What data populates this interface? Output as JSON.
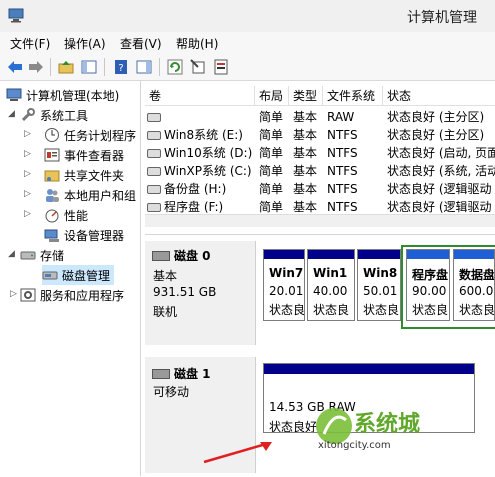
{
  "window": {
    "title": "计算机管理"
  },
  "menu": [
    "文件(F)",
    "操作(A)",
    "查看(V)",
    "帮助(H)"
  ],
  "tree": {
    "root": "计算机管理(本地)",
    "system_tools": "系统工具",
    "task_scheduler": "任务计划程序",
    "event_viewer": "事件查看器",
    "shared_folders": "共享文件夹",
    "local_users": "本地用户和组",
    "performance": "性能",
    "device_manager": "设备管理器",
    "storage": "存储",
    "disk_management": "磁盘管理",
    "services_apps": "服务和应用程序"
  },
  "volume_table": {
    "headers": [
      "卷",
      "布局",
      "类型",
      "文件系统",
      "状态"
    ],
    "rows": [
      {
        "volume": "",
        "layout": "简单",
        "type": "基本",
        "fs": "RAW",
        "status": "状态良好 (主分区)"
      },
      {
        "volume": "Win8系统 (E:)",
        "layout": "简单",
        "type": "基本",
        "fs": "NTFS",
        "status": "状态良好 (主分区)"
      },
      {
        "volume": "Win10系统 (D:)",
        "layout": "简单",
        "type": "基本",
        "fs": "NTFS",
        "status": "状态良好 (启动, 页面"
      },
      {
        "volume": "WinXP系统 (C:)",
        "layout": "简单",
        "type": "基本",
        "fs": "NTFS",
        "status": "状态良好 (系统, 活动"
      },
      {
        "volume": "备份盘 (H:)",
        "layout": "简单",
        "type": "基本",
        "fs": "NTFS",
        "status": "状态良好 (逻辑驱动"
      },
      {
        "volume": "程序盘 (F:)",
        "layout": "简单",
        "type": "基本",
        "fs": "NTFS",
        "status": "状态良好 (逻辑驱动"
      }
    ]
  },
  "disk0": {
    "name": "磁盘 0",
    "type": "基本",
    "size": "931.51 GB",
    "status": "联机",
    "partitions": [
      {
        "name": "Win7",
        "size": "20.01",
        "status": "状态良"
      },
      {
        "name": "Win1",
        "size": "40.00",
        "status": "状态良"
      },
      {
        "name": "Win8",
        "size": "50.01",
        "status": "状态良"
      },
      {
        "name": "程序盘",
        "size": "90.00",
        "status": "状态良"
      },
      {
        "name": "数据盘",
        "size": "600.0",
        "status": "状态良"
      }
    ]
  },
  "disk1": {
    "name": "磁盘 1",
    "type": "可移动",
    "partition": {
      "size": "14.53 GB RAW",
      "status": "状态良好"
    }
  },
  "watermark": {
    "text": "系统城",
    "url": "xitongcity.com"
  },
  "colors": {
    "primary_bar": "#00008b",
    "logical_bar": "#1f5fd6",
    "selection": "#cce8ff",
    "extended_border": "#2e8b2e"
  }
}
